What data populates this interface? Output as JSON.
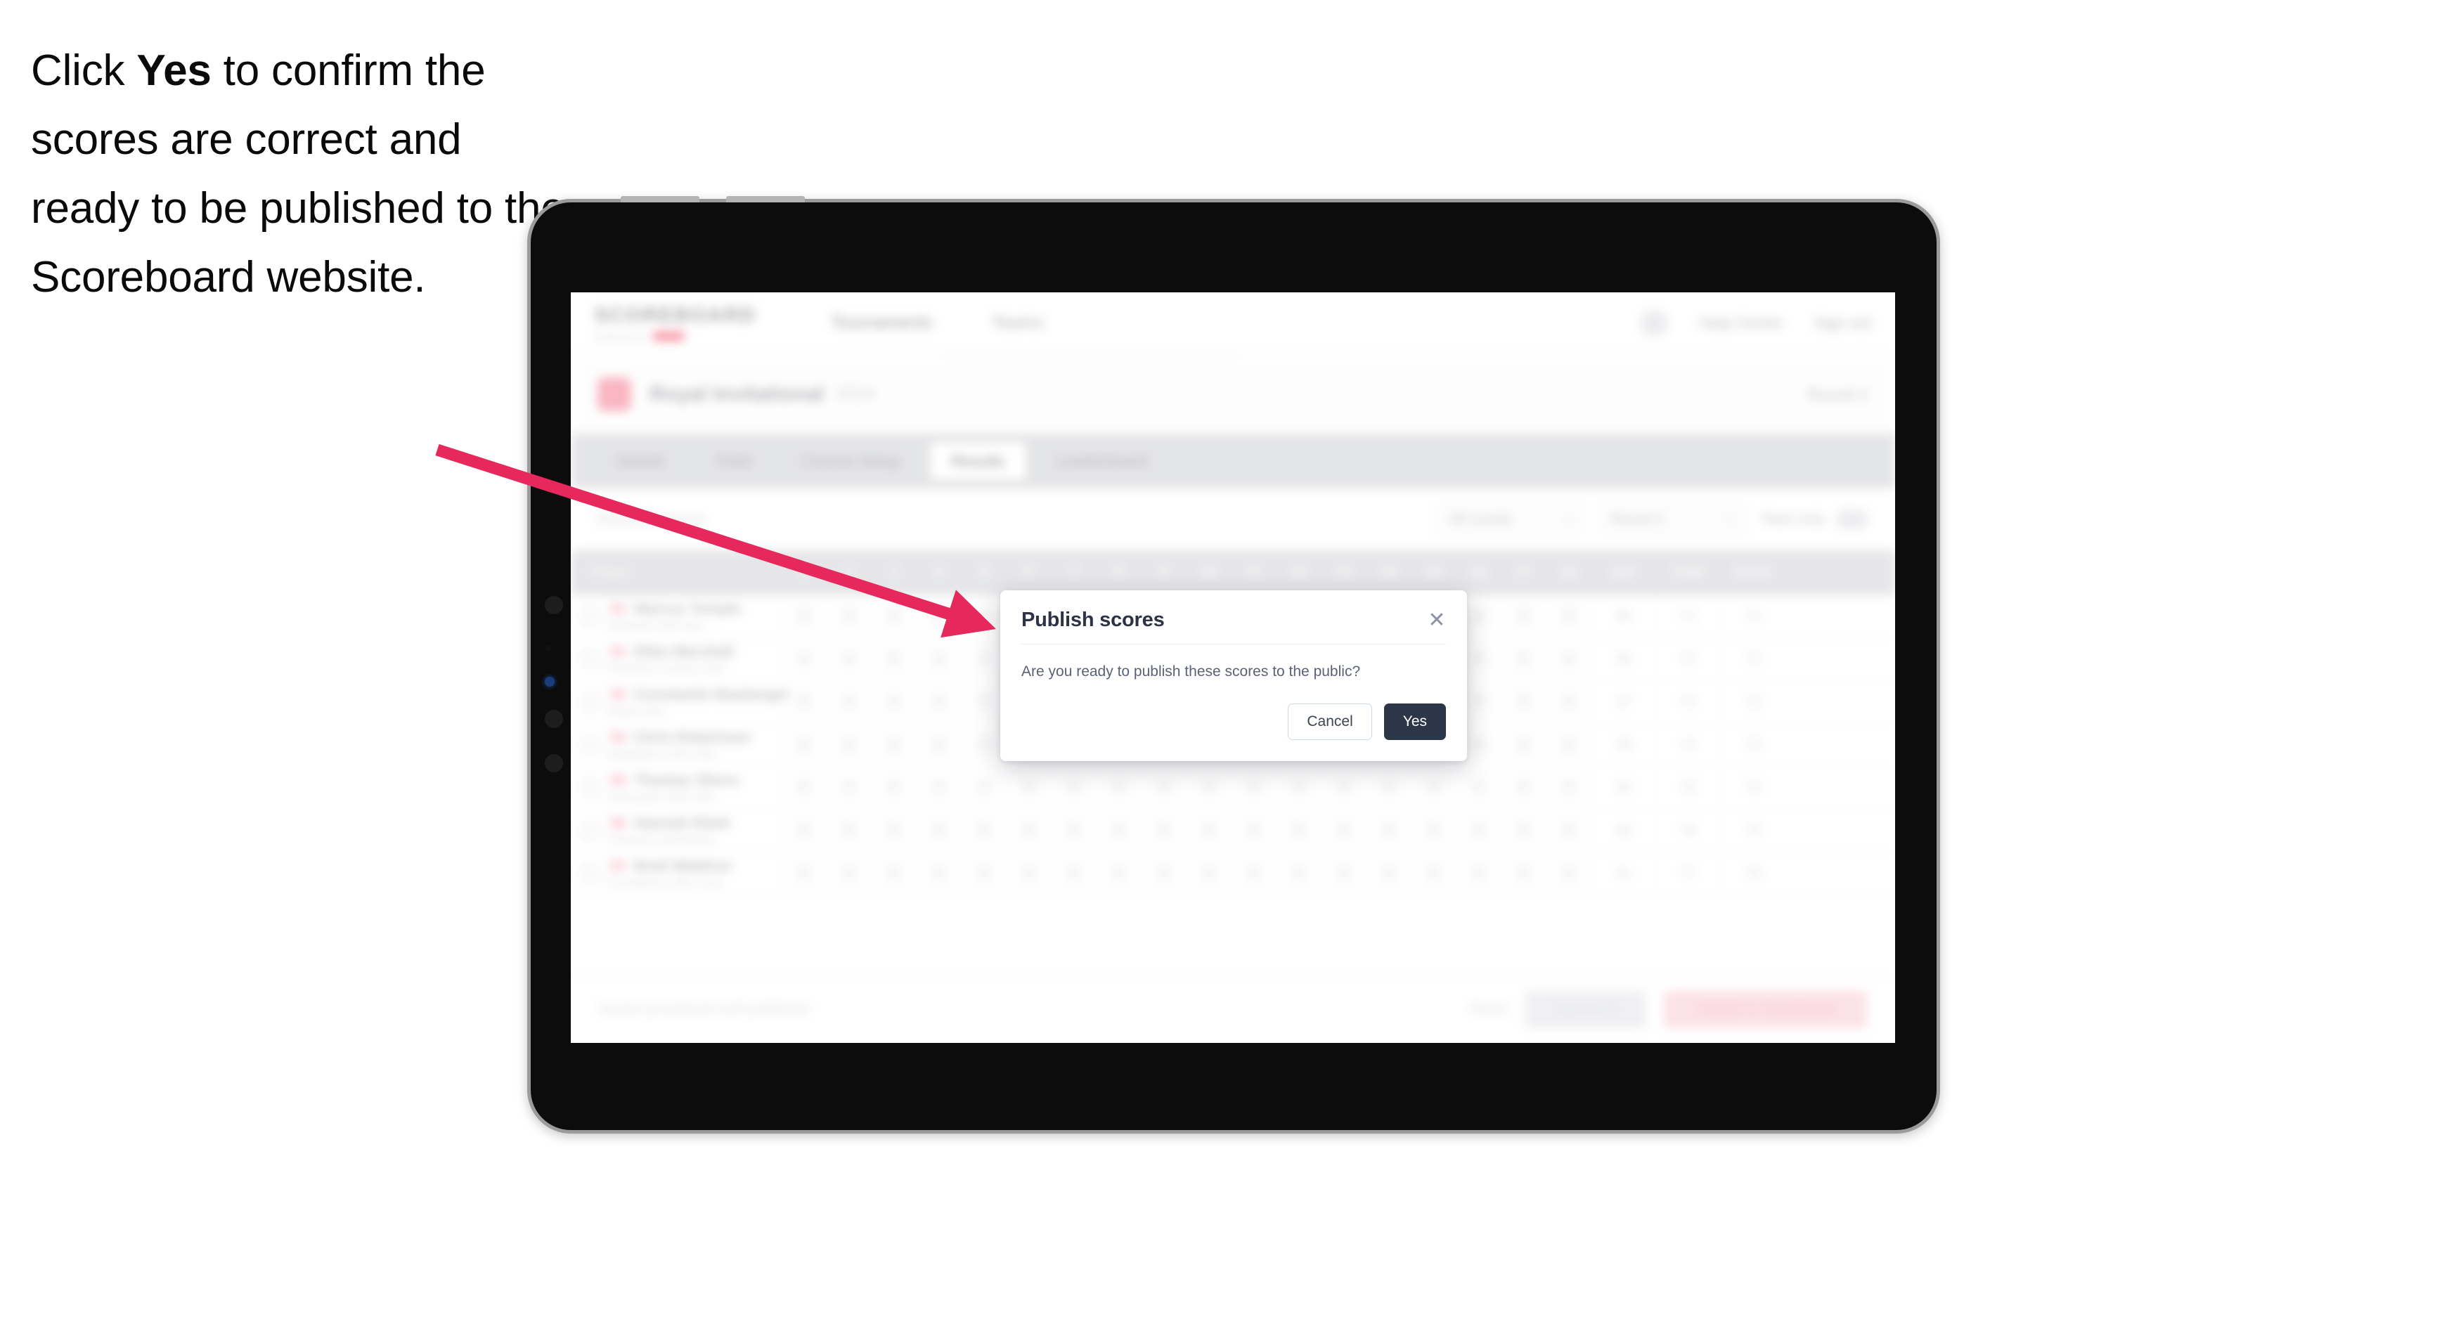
{
  "caption": {
    "before": "Click ",
    "strong": "Yes",
    "after": " to confirm the scores are correct and ready to be published to the Scoreboard website."
  },
  "annotation": {
    "arrow_color": "#e6285c",
    "arrow_from": "caption",
    "arrow_to": "publish-scores-dialog"
  },
  "device": {
    "type": "tablet",
    "bezel_color": "#9b9b9b",
    "body_color": "#0c0c0c"
  },
  "app": {
    "brand": {
      "wordmark": "SCOREBOARD",
      "tagline": "powered by",
      "accent_color": "#f4566f"
    },
    "topnav": [
      {
        "label": "Tournaments",
        "active": true
      },
      {
        "label": "Teams",
        "active": false
      }
    ],
    "topright": {
      "icon": "help-icon",
      "links": [
        "Help Centre",
        "Sign out"
      ]
    },
    "event": {
      "title": "Royal Invitational",
      "subtitle": "2024",
      "right_label": "Round 2"
    },
    "tabs": [
      {
        "label": "Details",
        "active": false
      },
      {
        "label": "Field",
        "active": false
      },
      {
        "label": "Course Setup",
        "active": false
      },
      {
        "label": "Results",
        "active": true
      },
      {
        "label": "Leaderboard",
        "active": false
      }
    ],
    "filters": {
      "left_note": "Round 2 scores",
      "selects": [
        {
          "label": "All rounds",
          "caret": "▾"
        },
        {
          "label": "Round 2",
          "caret": "▾"
        }
      ],
      "toggle": {
        "label": "Team only",
        "on": false
      }
    },
    "table": {
      "headers": {
        "player": "Player",
        "holes": [
          "1",
          "2",
          "3",
          "4",
          "5",
          "6",
          "7",
          "8",
          "9",
          "10",
          "11",
          "12",
          "13",
          "14",
          "15",
          "16",
          "17",
          "18"
        ],
        "out": "Out",
        "total": "Total",
        "score": "Score"
      },
      "rows": [
        {
          "badge": "T1",
          "name": "Marcus Temple",
          "club": "Oakmont Golf Club",
          "holes": [
            "4",
            "3",
            "5",
            "4",
            "4",
            "3",
            "5",
            "4",
            "4",
            "3",
            "4",
            "5",
            "4",
            "4",
            "3",
            "4",
            "5",
            "4"
          ],
          "out": "36",
          "total": "72",
          "score": "-1",
          "score2": "71"
        },
        {
          "badge": "T1",
          "name": "Ellen Marshall",
          "club": "Pinehurst Country Club",
          "holes": [
            "4",
            "4",
            "5",
            "3",
            "4",
            "4",
            "5",
            "4",
            "3",
            "4",
            "4",
            "5",
            "3",
            "4",
            "4",
            "4",
            "5",
            "4"
          ],
          "out": "36",
          "total": "72",
          "score": "-1",
          "score2": "71"
        },
        {
          "badge": "T3",
          "name": "Constantin Bauberger",
          "club": "Royal Links",
          "holes": [
            "5",
            "4",
            "4",
            "4",
            "4",
            "3",
            "5",
            "4",
            "4",
            "4",
            "4",
            "4",
            "4",
            "4",
            "4",
            "4",
            "5",
            "4"
          ],
          "out": "37",
          "total": "73",
          "score": "E",
          "score2": "72"
        },
        {
          "badge": "T4",
          "name": "Chris Robertson",
          "club": "Kingsbarns Golf Links",
          "holes": [
            "4",
            "4",
            "5",
            "4",
            "5",
            "4",
            "5",
            "4",
            "4",
            "4",
            "4",
            "5",
            "4",
            "4",
            "4",
            "4",
            "5",
            "5"
          ],
          "out": "39",
          "total": "74",
          "score": "+1",
          "score2": "73"
        },
        {
          "badge": "T5",
          "name": "Thomas Okoro",
          "club": "Carnoustie Golf Links",
          "holes": [
            "5",
            "4",
            "5",
            "4",
            "4",
            "4",
            "5",
            "5",
            "4",
            "4",
            "5",
            "4",
            "4",
            "5",
            "4",
            "4",
            "5",
            "4"
          ],
          "out": "40",
          "total": "75",
          "score": "+2",
          "score2": "74"
        },
        {
          "badge": "T6",
          "name": "Hannah Eliott",
          "club": "Turnberry Golf Resort",
          "holes": [
            "4",
            "5",
            "5",
            "4",
            "5",
            "4",
            "5",
            "4",
            "5",
            "4",
            "4",
            "5",
            "4",
            "4",
            "5",
            "4",
            "5",
            "4"
          ],
          "out": "40",
          "total": "76",
          "score": "+3",
          "score2": "75"
        },
        {
          "badge": "T7",
          "name": "Brett Waldron",
          "club": "St Andrews Links Trust",
          "holes": [
            "5",
            "4",
            "5",
            "5",
            "4",
            "4",
            "5",
            "5",
            "4",
            "4",
            "5",
            "5",
            "4",
            "4",
            "5",
            "5",
            "5",
            "4"
          ],
          "out": "41",
          "total": "77",
          "score": "+4",
          "score2": "76"
        }
      ]
    },
    "bottombar": {
      "note": "Scores provisional until published",
      "link": "Reset",
      "secondary_button": "Save draft",
      "primary_button": "Publish to Scoreboard"
    }
  },
  "dialog": {
    "title": "Publish scores",
    "close_icon": "✕",
    "body": "Are you ready to publish these scores to the public?",
    "cancel_label": "Cancel",
    "confirm_label": "Yes",
    "confirm_color": "#2b3648",
    "cancel_border_color": "#ccd6ea"
  }
}
